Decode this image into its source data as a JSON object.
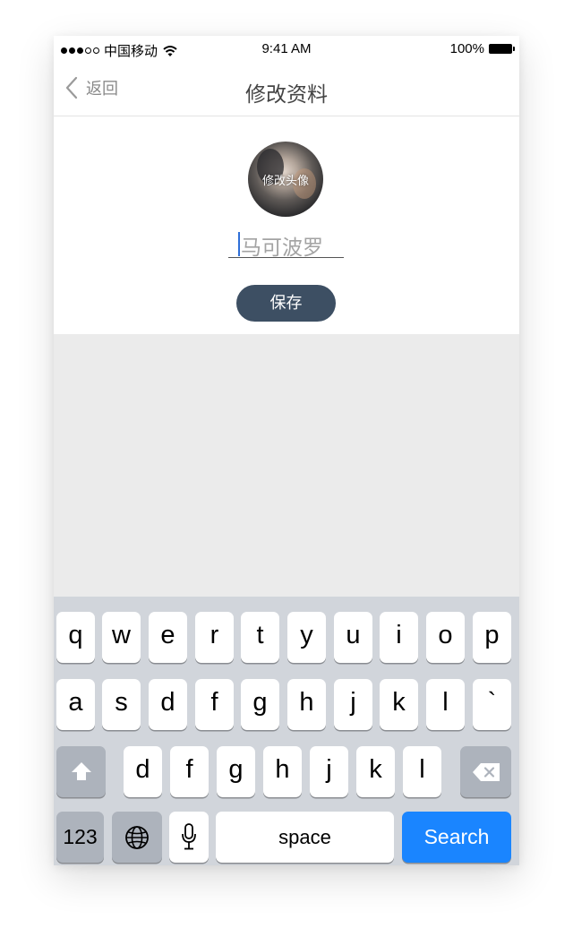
{
  "status_bar": {
    "carrier": "中国移动",
    "time": "9:41 AM",
    "battery": "100%",
    "signal_dots_filled": 3,
    "signal_dots_total": 5
  },
  "nav": {
    "back_label": "返回",
    "title": "修改资料"
  },
  "profile": {
    "avatar_label": "修改头像",
    "name_placeholder": "马可波罗",
    "save_label": "保存"
  },
  "keyboard": {
    "row1": [
      "q",
      "w",
      "e",
      "r",
      "t",
      "y",
      "u",
      "i",
      "o",
      "p"
    ],
    "row2": [
      "a",
      "s",
      "d",
      "f",
      "g",
      "h",
      "j",
      "k",
      "l",
      "`"
    ],
    "row3": [
      "d",
      "f",
      "g",
      "h",
      "j",
      "k",
      "l"
    ],
    "numbers_label": "123",
    "space_label": "space",
    "search_label": "Search"
  },
  "colors": {
    "accent": "#1a85ff",
    "save_button": "#3d4f63",
    "keyboard_bg": "#d1d5db",
    "page_bg": "#ebebeb"
  },
  "icons": [
    "back-chevron-icon",
    "wifi-icon",
    "battery-icon",
    "shift-icon",
    "backspace-icon",
    "globe-icon",
    "microphone-icon"
  ]
}
